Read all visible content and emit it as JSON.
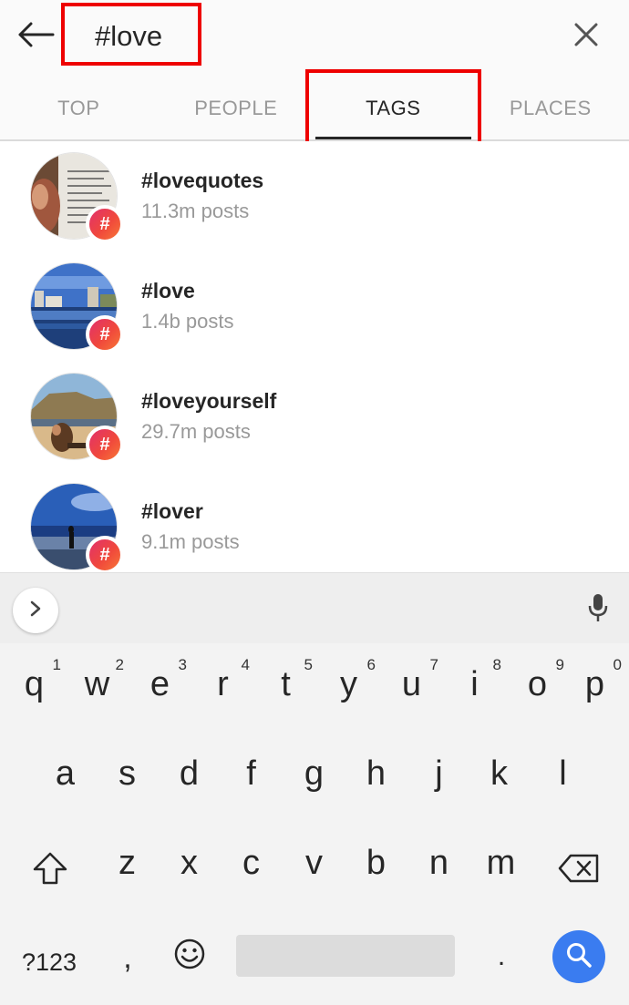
{
  "search": {
    "query": "#love",
    "back_icon": "arrow-left-icon",
    "clear_icon": "close-icon"
  },
  "tabs": [
    {
      "label": "TOP",
      "active": false
    },
    {
      "label": "PEOPLE",
      "active": false
    },
    {
      "label": "TAGS",
      "active": true
    },
    {
      "label": "PLACES",
      "active": false
    }
  ],
  "results": [
    {
      "tag": "#lovequotes",
      "posts": "11.3m posts",
      "thumb": "quote-text-photo"
    },
    {
      "tag": "#love",
      "posts": "1.4b posts",
      "thumb": "city-waterfront-photo"
    },
    {
      "tag": "#loveyourself",
      "posts": "29.7m posts",
      "thumb": "beach-cliff-photo"
    },
    {
      "tag": "#lover",
      "posts": "9.1m posts",
      "thumb": "beach-silhouette-photo"
    }
  ],
  "hashtag_badge": "#",
  "keyboard": {
    "row1": [
      {
        "key": "q",
        "alt": "1"
      },
      {
        "key": "w",
        "alt": "2"
      },
      {
        "key": "e",
        "alt": "3"
      },
      {
        "key": "r",
        "alt": "4"
      },
      {
        "key": "t",
        "alt": "5"
      },
      {
        "key": "y",
        "alt": "6"
      },
      {
        "key": "u",
        "alt": "7"
      },
      {
        "key": "i",
        "alt": "8"
      },
      {
        "key": "o",
        "alt": "9"
      },
      {
        "key": "p",
        "alt": "0"
      }
    ],
    "row2": [
      "a",
      "s",
      "d",
      "f",
      "g",
      "h",
      "j",
      "k",
      "l"
    ],
    "row3": [
      "z",
      "x",
      "c",
      "v",
      "b",
      "n",
      "m"
    ],
    "symbols": "?123",
    "comma": ",",
    "period": ".",
    "icons": {
      "expand": "chevron-right-icon",
      "mic": "microphone-icon",
      "shift": "shift-icon",
      "backspace": "backspace-icon",
      "emoji": "emoji-icon",
      "search": "search-icon"
    }
  },
  "colors": {
    "highlight": "#ee0000",
    "search_key": "#3a7cf0",
    "muted_text": "#999999"
  }
}
